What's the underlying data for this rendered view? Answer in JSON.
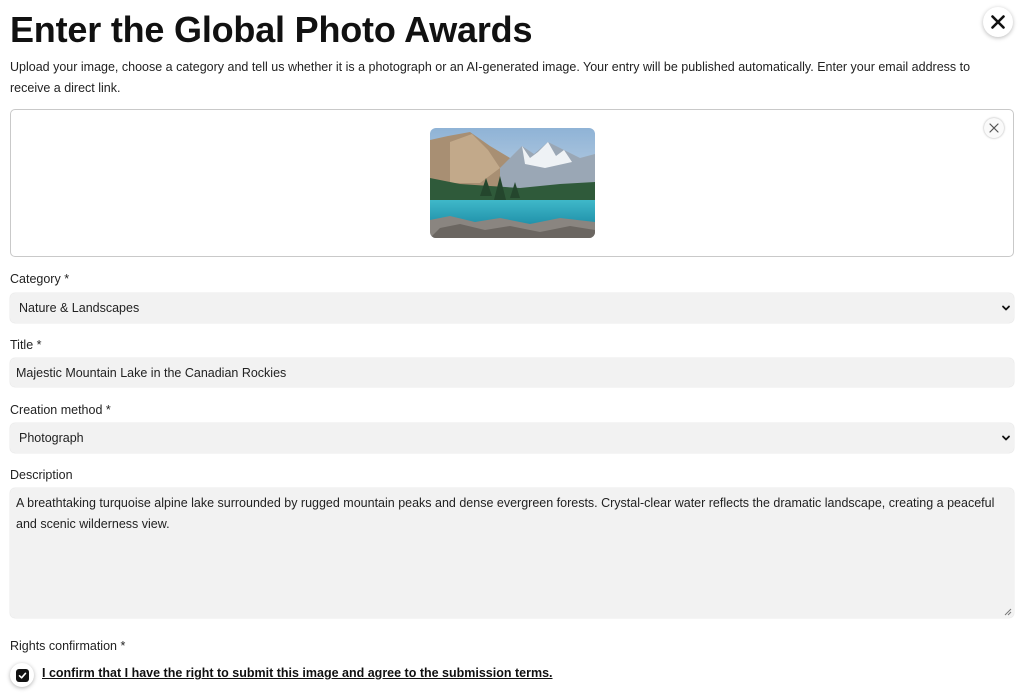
{
  "header": {
    "title": "Enter the Global Photo Awards",
    "intro": "Upload your image, choose a category and tell us whether it is a photograph or an AI-generated image. Your entry will be published automatically. Enter your email address to receive a direct link."
  },
  "upload": {
    "thumbnail_icon": "mountain-lake-photo",
    "remove_icon": "close-icon"
  },
  "form": {
    "category": {
      "label": "Category *",
      "value": "Nature & Landscapes"
    },
    "title": {
      "label": "Title *",
      "value": "Majestic Mountain Lake in the Canadian Rockies"
    },
    "creation_method": {
      "label": "Creation method *",
      "value": "Photograph"
    },
    "description": {
      "label": "Description",
      "value": "A breathtaking turquoise alpine lake surrounded by rugged mountain peaks and dense evergreen forests. Crystal-clear water reflects the dramatic landscape, creating a peaceful and scenic wilderness view."
    },
    "rights": {
      "label": "Rights confirmation *",
      "confirm_text": "I confirm that I have the right to submit this image and agree to the submission terms.",
      "checked": true
    }
  },
  "colors": {
    "field_bg": "#f2f2f2",
    "text": "#1a1a1a",
    "border": "#c9c9c9"
  }
}
